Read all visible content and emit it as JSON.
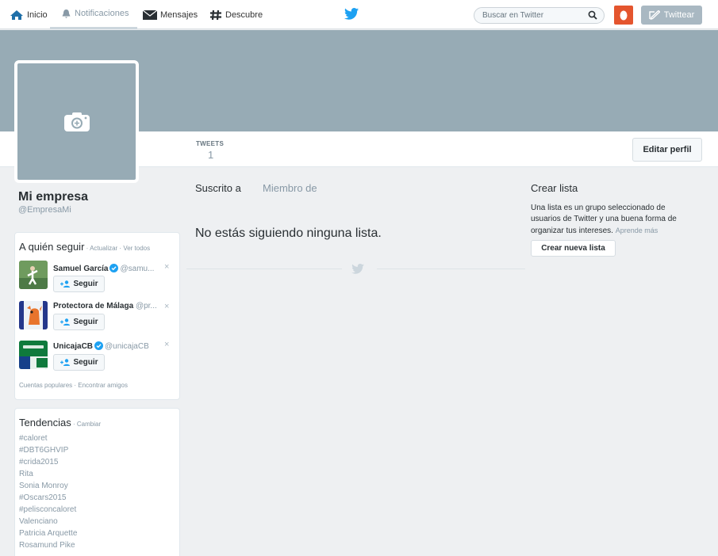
{
  "nav": {
    "home": "Inicio",
    "notifications": "Notificaciones",
    "messages": "Mensajes",
    "discover": "Descubre",
    "search_placeholder": "Buscar en Twitter",
    "tweet_button": "Twittear"
  },
  "profile": {
    "name": "Mi empresa",
    "handle": "@EmpresaMi",
    "edit_button": "Editar perfil",
    "stats": {
      "tweets_label": "TWEETS",
      "tweets_value": "1"
    }
  },
  "who_to_follow": {
    "title": "A quién seguir",
    "sep1": " · ",
    "refresh": "Actualizar",
    "sep2": " · ",
    "view_all": "Ver todos",
    "follow_label": "Seguir",
    "dismiss": "×",
    "suggestions": [
      {
        "name": "Samuel García",
        "handle": "@samu..."
      },
      {
        "name": "Protectora de Málaga",
        "handle": "@pr..."
      },
      {
        "name": "UnicajaCB",
        "handle": "@unicajaCB"
      }
    ],
    "footer": "Cuentas populares · Encontrar amigos"
  },
  "trends": {
    "title": "Tendencias",
    "change": " · Cambiar",
    "items": [
      "#caloret",
      "#DBT6GHVIP",
      "#crida2015",
      "Rita",
      "Sonia Monroy",
      "#Oscars2015",
      "#pelisconcaloret",
      "Valenciano",
      "Patricia Arquette",
      "Rosamund Pike"
    ]
  },
  "lists": {
    "tab_subscribed": "Suscrito a",
    "tab_member": "Miembro de",
    "empty_message": "No estás siguiendo ninguna lista."
  },
  "create_list": {
    "title": "Crear lista",
    "description": "Una lista es un grupo seleccionado de usuarios de Twitter y una buena forma de organizar tus intereses.",
    "learn_more": "Aprende más",
    "button": "Crear nueva lista"
  },
  "colors": {
    "banner": "#97abb5",
    "twitter_blue": "#1da1f2",
    "verified": "#1da1f2",
    "avatar_orange": "#e4552e",
    "tweet_button": "#a9b8c2"
  }
}
